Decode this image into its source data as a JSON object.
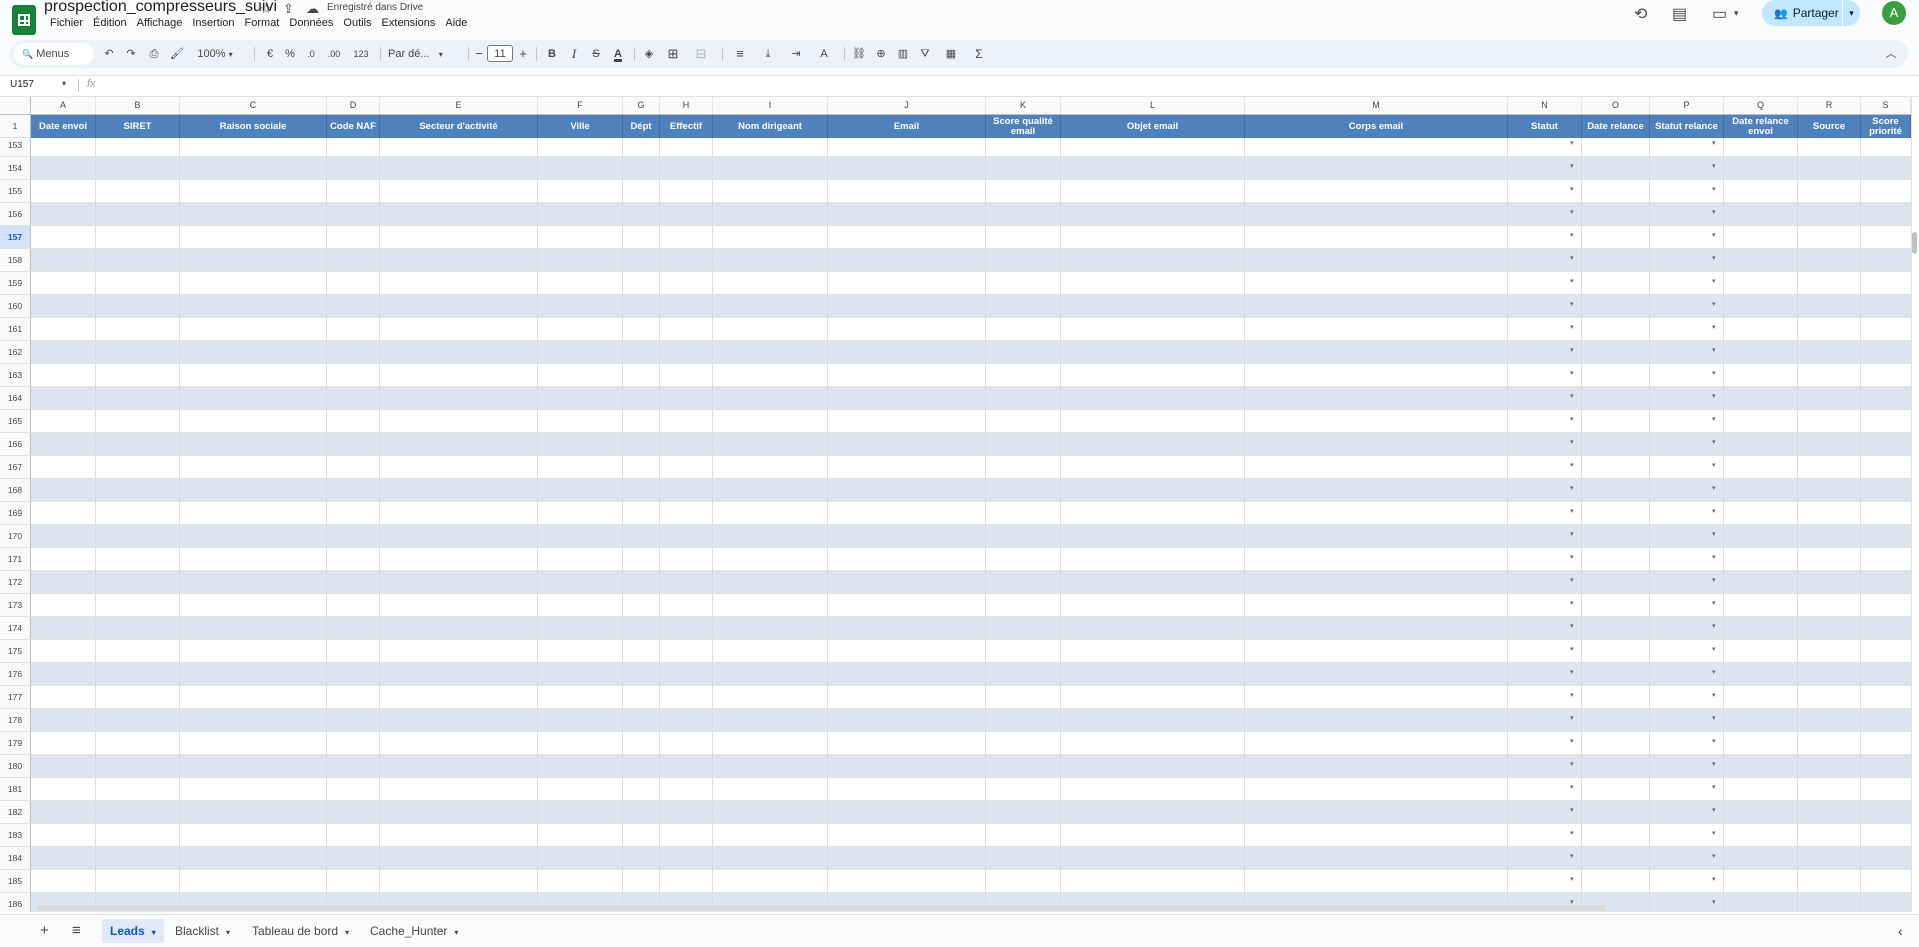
{
  "doc": {
    "title": "prospection_compresseurs_suivi",
    "saved_status": "Enregistré dans Drive",
    "star_icon": "☆",
    "move_icon": "⇪",
    "cloud_icon": "☁"
  },
  "menu": [
    "Fichier",
    "Édition",
    "Affichage",
    "Insertion",
    "Format",
    "Données",
    "Outils",
    "Extensions",
    "Aide"
  ],
  "topright": {
    "history_icon": "⟲",
    "comment_icon": "▤",
    "meet_icon": "▭",
    "meet_arrow": "▾",
    "share_icon": "👥",
    "share_label": "Partager",
    "share_arrow": "▾",
    "avatar_letter": "A"
  },
  "toolbar": {
    "search_label": "Menus",
    "search_icon": "🔍",
    "undo": "↶",
    "redo": "↷",
    "print": "⎙",
    "paint_format": "🖌",
    "zoom": "100%",
    "zoom_arrow": "▾",
    "currency": "€",
    "percent": "%",
    "dec_decrease": ".0",
    "dec_increase": ".00",
    "more_formats": "123",
    "font": "Par dé...",
    "font_arrow": "▾",
    "minus": "−",
    "font_size": "11",
    "plus": "+",
    "bold": "B",
    "italic": "I",
    "strike": "S",
    "text_color": "A",
    "fill_color": "◈",
    "borders": "⊞",
    "merge": "⊟",
    "h_align": "≡",
    "v_align": "⤓",
    "wrap": "⇥",
    "rotate": "A",
    "link": "⛓",
    "comment": "⊕",
    "chart": "▥",
    "filter": "⛛",
    "filter_views": "▦",
    "functions": "Σ",
    "collapse": "︿"
  },
  "formula_bar": {
    "name_box": "U157",
    "name_box_arrow": "▾",
    "fx": "fx",
    "formula": ""
  },
  "columns": [
    {
      "letter": "A",
      "header": "Date envoi",
      "dropdown": false
    },
    {
      "letter": "B",
      "header": "SIRET",
      "dropdown": false
    },
    {
      "letter": "C",
      "header": "Raison sociale",
      "dropdown": false
    },
    {
      "letter": "D",
      "header": "Code NAF",
      "dropdown": false
    },
    {
      "letter": "E",
      "header": "Secteur d'activité",
      "dropdown": false
    },
    {
      "letter": "F",
      "header": "Ville",
      "dropdown": false
    },
    {
      "letter": "G",
      "header": "Dépt",
      "dropdown": false
    },
    {
      "letter": "H",
      "header": "Effectif",
      "dropdown": false
    },
    {
      "letter": "I",
      "header": "Nom dirigeant",
      "dropdown": false
    },
    {
      "letter": "J",
      "header": "Email",
      "dropdown": false
    },
    {
      "letter": "K",
      "header": "Score qualité email",
      "dropdown": false
    },
    {
      "letter": "L",
      "header": "Objet email",
      "dropdown": false
    },
    {
      "letter": "M",
      "header": "Corps email",
      "dropdown": false
    },
    {
      "letter": "N",
      "header": "Statut",
      "dropdown": true
    },
    {
      "letter": "O",
      "header": "Date relance",
      "dropdown": false
    },
    {
      "letter": "P",
      "header": "Statut relance",
      "dropdown": true
    },
    {
      "letter": "Q",
      "header": "Date relance envoi",
      "dropdown": false
    },
    {
      "letter": "R",
      "header": "Source",
      "dropdown": false
    },
    {
      "letter": "S",
      "header": "Score priorité",
      "dropdown": false
    }
  ],
  "header_row_number": "1",
  "rows": [
    "153",
    "154",
    "155",
    "156",
    "157",
    "158",
    "159",
    "160",
    "161",
    "162",
    "163",
    "164",
    "165",
    "166",
    "167",
    "168",
    "169",
    "170",
    "171",
    "172",
    "173",
    "174",
    "175",
    "176",
    "177",
    "178",
    "179",
    "180",
    "181",
    "182",
    "183",
    "184",
    "185",
    "186"
  ],
  "selected_row": "157",
  "dropdown_glyph": "▾",
  "sheets": {
    "add_icon": "+",
    "list_icon": "≡",
    "tab_arrow": "▾",
    "tabs": [
      "Leads",
      "Blacklist",
      "Tableau de bord",
      "Cache_Hunter"
    ],
    "active": "Leads",
    "explore_icon": "‹"
  },
  "colors": {
    "header_bg": "#4f81bd",
    "band": "#dce6f1",
    "active_tab": "#0b57d0",
    "share_bg": "#c2e7ff",
    "avatar": "#3a9e44"
  }
}
